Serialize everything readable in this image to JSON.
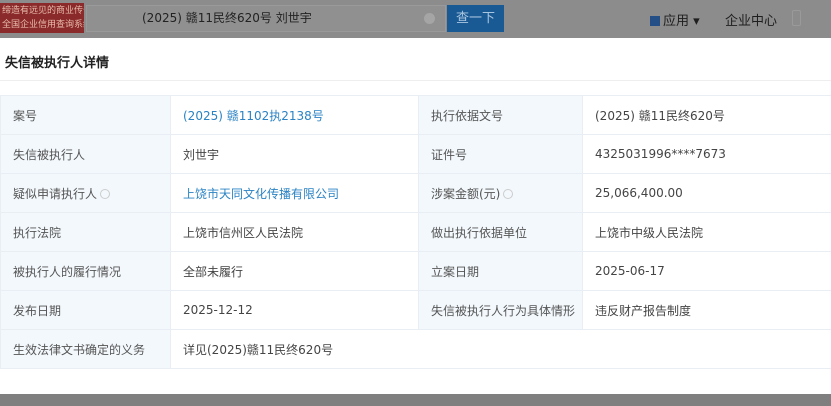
{
  "header": {
    "logo_lines": [
      "缔造有远见的商业传奇",
      "全国企业信用查询系统"
    ],
    "search_value": "(2025) 赣11民终620号 刘世宇",
    "search_button": "查一下",
    "apps": "应用 ▾",
    "enterprise_center": "企业中心"
  },
  "modal": {
    "title": "失信被执行人详情",
    "rows": [
      {
        "l1": "案号",
        "v1": "(2025) 赣1102执2138号",
        "l2": "执行依据文号",
        "v2": "(2025) 赣11民终620号"
      },
      {
        "l1": "失信被执行人",
        "v1": "刘世宇",
        "l2": "证件号",
        "v2": "4325031996****7673"
      },
      {
        "l1": "疑似申请执行人",
        "v1": "上饶市天同文化传播有限公司",
        "l2": "涉案金额(元)",
        "v2": "25,066,400.00"
      },
      {
        "l1": "执行法院",
        "v1": "上饶市信州区人民法院",
        "l2": "做出执行依据单位",
        "v2": "上饶市中级人民法院"
      },
      {
        "l1": "被执行人的履行情况",
        "v1": "全部未履行",
        "l2": "立案日期",
        "v2": "2025-06-17"
      },
      {
        "l1": "发布日期",
        "v1": "2025-12-12",
        "l2": "失信被执行人行为具体情形",
        "v2": "违反财产报告制度"
      },
      {
        "l1": "生效法律文书确定的义务",
        "v1": "详见(2025)赣11民终620号"
      }
    ]
  },
  "colors": {
    "link": "#2b83c4",
    "label_bg": "#f3f8fc"
  }
}
